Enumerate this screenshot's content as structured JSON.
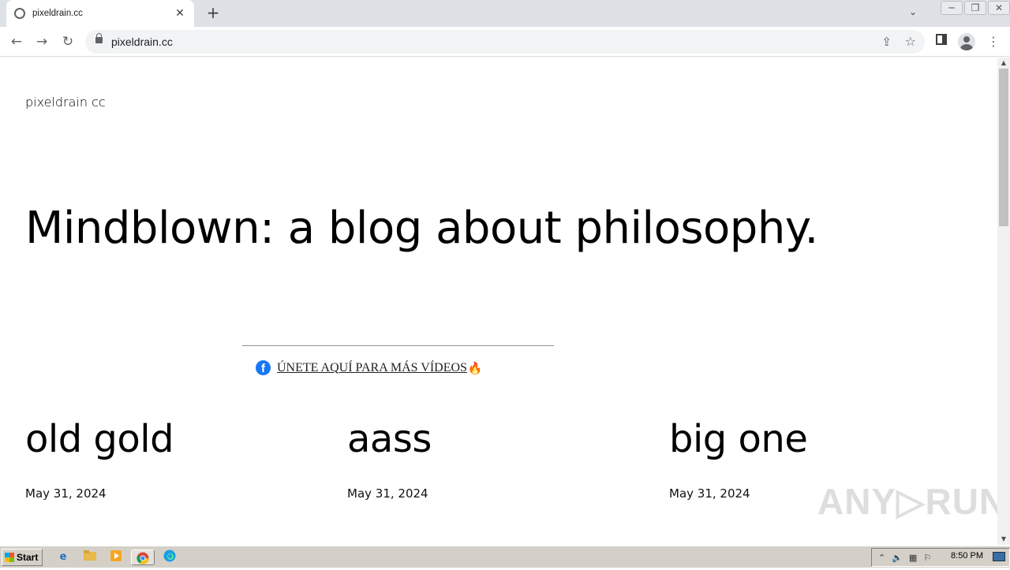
{
  "browser": {
    "tab_title": "pixeldrain.cc",
    "tab_close": "✕",
    "new_tab": "+",
    "tab_menu": "⌄",
    "url": "pixeldrain.cc",
    "back": "←",
    "forward": "→",
    "reload": "↻",
    "window_controls": {
      "minimize": "─",
      "restore": "❐",
      "close": "✕"
    }
  },
  "page": {
    "site_title": "pixeldrain cc",
    "headline": "Mindblown: a blog about philosophy.",
    "promo_link": "ÚNETE AQUÍ PARA MÁS VÍDEOS",
    "promo_icon": "f",
    "promo_emoji": "🔥",
    "posts": [
      {
        "title": "old gold",
        "date": "May 31, 2024"
      },
      {
        "title": "aass",
        "date": "May 31, 2024"
      },
      {
        "title": "big one",
        "date": "May 31, 2024"
      }
    ],
    "watermark": "ANY▷RUN"
  },
  "taskbar": {
    "start_label": "Start",
    "clock": "8:50 PM"
  },
  "colors": {
    "tabbar": "#dee1e6",
    "omnibox": "#f1f3f4",
    "facebook": "#1877f2",
    "taskbar": "#d4d0c8"
  }
}
